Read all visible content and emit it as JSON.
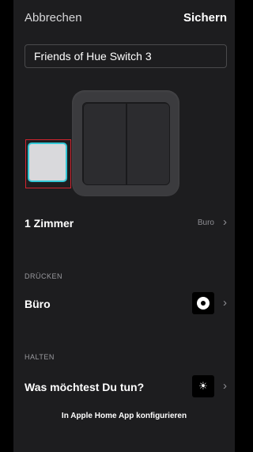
{
  "topbar": {
    "cancel_label": "Abbrechen",
    "save_label": "Sichern"
  },
  "name_field": {
    "value": "Friends of Hue Switch 3"
  },
  "rooms": {
    "title": "1 Zimmer",
    "value": "Buro",
    "chevron": "›"
  },
  "press": {
    "header": "DRÜCKEN",
    "title": "Büro",
    "icon": "scene-ring-icon",
    "chevron": "›"
  },
  "hold": {
    "header": "HALTEN",
    "title": "Was möchtest Du tun?",
    "icon": "brightness-icon",
    "icon_glyph": "☀",
    "chevron": "›"
  },
  "footer": {
    "label": "In Apple Home App konfigurieren"
  },
  "colors": {
    "background": "#1d1d1f",
    "selection_outline": "#33c7d6",
    "selection_frame": "#d1242f"
  }
}
